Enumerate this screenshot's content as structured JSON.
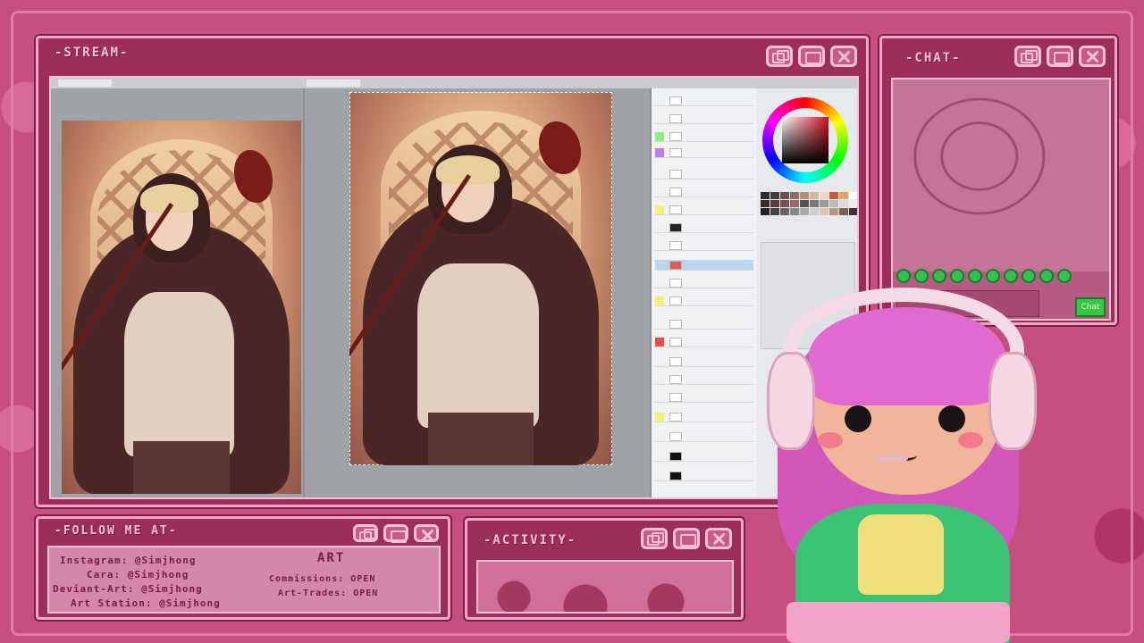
{
  "stream": {
    "title": "-STREAM-",
    "canvas_tabs": [
      "",
      ""
    ]
  },
  "chat": {
    "title": "-CHAT-",
    "send_label": "Chat"
  },
  "follow": {
    "title": "-FOLLOW ME AT-",
    "lines": [
      "Instagram: @Simjhong",
      "Cara: @Simjhong",
      "Deviant-Art: @Simjhong",
      "Art Station: @Simjhong"
    ],
    "art_label": "ART",
    "commissions": "Commissions: OPEN",
    "art_trades": "Art-Trades: OPEN"
  },
  "activity": {
    "title": "-ACTIVITY-"
  },
  "colors": {
    "frame": "#c64f80",
    "window": "#9c2f59",
    "border": "#f3a6c3",
    "accent_green": "#38c942"
  },
  "icons": [
    "restore-icon",
    "maximize-icon",
    "close-icon",
    "color-wheel-icon"
  ]
}
